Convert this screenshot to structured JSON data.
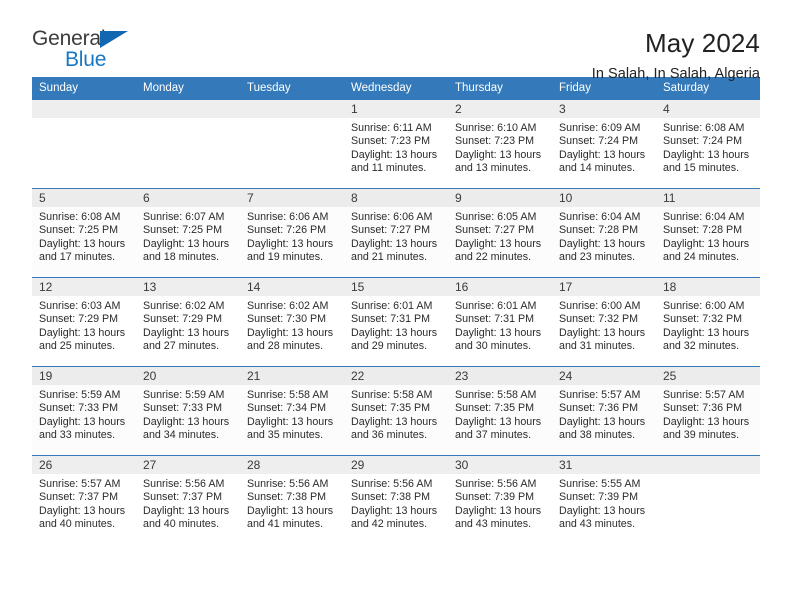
{
  "logo": {
    "word_one": "General",
    "word_two": "Blue",
    "triangle_color": "#1267b0",
    "blue_color": "#1878c4"
  },
  "header": {
    "title": "May 2024",
    "subtitle": "In Salah, In Salah, Algeria"
  },
  "theme": {
    "header_blue": "#3479b9",
    "daynum_band": "#eeeeee",
    "text": "#2b2b2b"
  },
  "weekdays": [
    "Sunday",
    "Monday",
    "Tuesday",
    "Wednesday",
    "Thursday",
    "Friday",
    "Saturday"
  ],
  "labels": {
    "sunrise_prefix": "Sunrise:",
    "sunset_prefix": "Sunset:",
    "daylight_prefix": "Daylight:"
  },
  "weeks": [
    [
      {
        "day": "",
        "l1": "",
        "l2": "",
        "l3": "",
        "l4": ""
      },
      {
        "day": "",
        "l1": "",
        "l2": "",
        "l3": "",
        "l4": ""
      },
      {
        "day": "",
        "l1": "",
        "l2": "",
        "l3": "",
        "l4": ""
      },
      {
        "day": "1",
        "l1": "Sunrise: 6:11 AM",
        "l2": "Sunset: 7:23 PM",
        "l3": "Daylight: 13 hours",
        "l4": "and 11 minutes."
      },
      {
        "day": "2",
        "l1": "Sunrise: 6:10 AM",
        "l2": "Sunset: 7:23 PM",
        "l3": "Daylight: 13 hours",
        "l4": "and 13 minutes."
      },
      {
        "day": "3",
        "l1": "Sunrise: 6:09 AM",
        "l2": "Sunset: 7:24 PM",
        "l3": "Daylight: 13 hours",
        "l4": "and 14 minutes."
      },
      {
        "day": "4",
        "l1": "Sunrise: 6:08 AM",
        "l2": "Sunset: 7:24 PM",
        "l3": "Daylight: 13 hours",
        "l4": "and 15 minutes."
      }
    ],
    [
      {
        "day": "5",
        "l1": "Sunrise: 6:08 AM",
        "l2": "Sunset: 7:25 PM",
        "l3": "Daylight: 13 hours",
        "l4": "and 17 minutes."
      },
      {
        "day": "6",
        "l1": "Sunrise: 6:07 AM",
        "l2": "Sunset: 7:25 PM",
        "l3": "Daylight: 13 hours",
        "l4": "and 18 minutes."
      },
      {
        "day": "7",
        "l1": "Sunrise: 6:06 AM",
        "l2": "Sunset: 7:26 PM",
        "l3": "Daylight: 13 hours",
        "l4": "and 19 minutes."
      },
      {
        "day": "8",
        "l1": "Sunrise: 6:06 AM",
        "l2": "Sunset: 7:27 PM",
        "l3": "Daylight: 13 hours",
        "l4": "and 21 minutes."
      },
      {
        "day": "9",
        "l1": "Sunrise: 6:05 AM",
        "l2": "Sunset: 7:27 PM",
        "l3": "Daylight: 13 hours",
        "l4": "and 22 minutes."
      },
      {
        "day": "10",
        "l1": "Sunrise: 6:04 AM",
        "l2": "Sunset: 7:28 PM",
        "l3": "Daylight: 13 hours",
        "l4": "and 23 minutes."
      },
      {
        "day": "11",
        "l1": "Sunrise: 6:04 AM",
        "l2": "Sunset: 7:28 PM",
        "l3": "Daylight: 13 hours",
        "l4": "and 24 minutes."
      }
    ],
    [
      {
        "day": "12",
        "l1": "Sunrise: 6:03 AM",
        "l2": "Sunset: 7:29 PM",
        "l3": "Daylight: 13 hours",
        "l4": "and 25 minutes."
      },
      {
        "day": "13",
        "l1": "Sunrise: 6:02 AM",
        "l2": "Sunset: 7:29 PM",
        "l3": "Daylight: 13 hours",
        "l4": "and 27 minutes."
      },
      {
        "day": "14",
        "l1": "Sunrise: 6:02 AM",
        "l2": "Sunset: 7:30 PM",
        "l3": "Daylight: 13 hours",
        "l4": "and 28 minutes."
      },
      {
        "day": "15",
        "l1": "Sunrise: 6:01 AM",
        "l2": "Sunset: 7:31 PM",
        "l3": "Daylight: 13 hours",
        "l4": "and 29 minutes."
      },
      {
        "day": "16",
        "l1": "Sunrise: 6:01 AM",
        "l2": "Sunset: 7:31 PM",
        "l3": "Daylight: 13 hours",
        "l4": "and 30 minutes."
      },
      {
        "day": "17",
        "l1": "Sunrise: 6:00 AM",
        "l2": "Sunset: 7:32 PM",
        "l3": "Daylight: 13 hours",
        "l4": "and 31 minutes."
      },
      {
        "day": "18",
        "l1": "Sunrise: 6:00 AM",
        "l2": "Sunset: 7:32 PM",
        "l3": "Daylight: 13 hours",
        "l4": "and 32 minutes."
      }
    ],
    [
      {
        "day": "19",
        "l1": "Sunrise: 5:59 AM",
        "l2": "Sunset: 7:33 PM",
        "l3": "Daylight: 13 hours",
        "l4": "and 33 minutes."
      },
      {
        "day": "20",
        "l1": "Sunrise: 5:59 AM",
        "l2": "Sunset: 7:33 PM",
        "l3": "Daylight: 13 hours",
        "l4": "and 34 minutes."
      },
      {
        "day": "21",
        "l1": "Sunrise: 5:58 AM",
        "l2": "Sunset: 7:34 PM",
        "l3": "Daylight: 13 hours",
        "l4": "and 35 minutes."
      },
      {
        "day": "22",
        "l1": "Sunrise: 5:58 AM",
        "l2": "Sunset: 7:35 PM",
        "l3": "Daylight: 13 hours",
        "l4": "and 36 minutes."
      },
      {
        "day": "23",
        "l1": "Sunrise: 5:58 AM",
        "l2": "Sunset: 7:35 PM",
        "l3": "Daylight: 13 hours",
        "l4": "and 37 minutes."
      },
      {
        "day": "24",
        "l1": "Sunrise: 5:57 AM",
        "l2": "Sunset: 7:36 PM",
        "l3": "Daylight: 13 hours",
        "l4": "and 38 minutes."
      },
      {
        "day": "25",
        "l1": "Sunrise: 5:57 AM",
        "l2": "Sunset: 7:36 PM",
        "l3": "Daylight: 13 hours",
        "l4": "and 39 minutes."
      }
    ],
    [
      {
        "day": "26",
        "l1": "Sunrise: 5:57 AM",
        "l2": "Sunset: 7:37 PM",
        "l3": "Daylight: 13 hours",
        "l4": "and 40 minutes."
      },
      {
        "day": "27",
        "l1": "Sunrise: 5:56 AM",
        "l2": "Sunset: 7:37 PM",
        "l3": "Daylight: 13 hours",
        "l4": "and 40 minutes."
      },
      {
        "day": "28",
        "l1": "Sunrise: 5:56 AM",
        "l2": "Sunset: 7:38 PM",
        "l3": "Daylight: 13 hours",
        "l4": "and 41 minutes."
      },
      {
        "day": "29",
        "l1": "Sunrise: 5:56 AM",
        "l2": "Sunset: 7:38 PM",
        "l3": "Daylight: 13 hours",
        "l4": "and 42 minutes."
      },
      {
        "day": "30",
        "l1": "Sunrise: 5:56 AM",
        "l2": "Sunset: 7:39 PM",
        "l3": "Daylight: 13 hours",
        "l4": "and 43 minutes."
      },
      {
        "day": "31",
        "l1": "Sunrise: 5:55 AM",
        "l2": "Sunset: 7:39 PM",
        "l3": "Daylight: 13 hours",
        "l4": "and 43 minutes."
      },
      {
        "day": "",
        "l1": "",
        "l2": "",
        "l3": "",
        "l4": ""
      }
    ]
  ]
}
